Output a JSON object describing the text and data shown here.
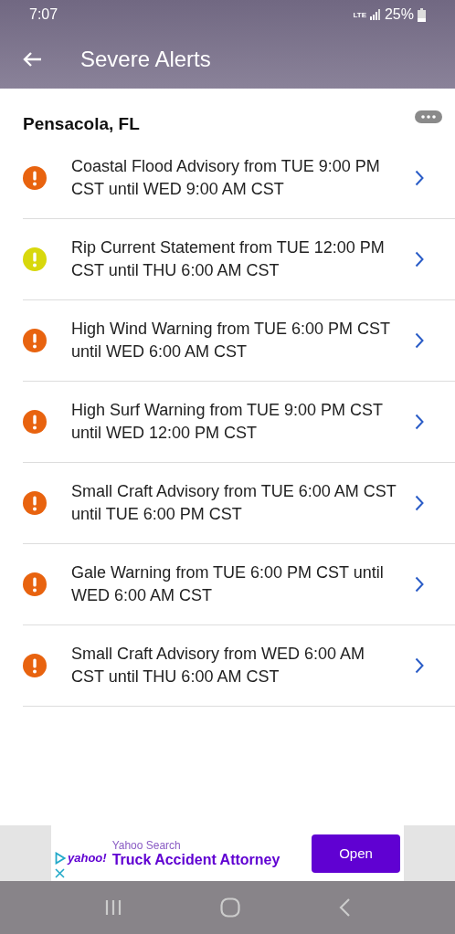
{
  "status_bar": {
    "time": "7:07",
    "network": "LTE",
    "battery": "25%"
  },
  "app_bar": {
    "title": "Severe Alerts"
  },
  "location": "Pensacola, FL",
  "alerts": [
    {
      "text": "Coastal Flood Advisory from TUE 9:00 PM CST until WED 9:00 AM CST",
      "color": "#e8630f"
    },
    {
      "text": "Rip Current Statement from TUE 12:00 PM CST until THU 6:00 AM CST",
      "color": "#d8d80c"
    },
    {
      "text": "High Wind Warning from TUE 6:00 PM CST until WED 6:00 AM CST",
      "color": "#e8630f"
    },
    {
      "text": "High Surf Warning from TUE 9:00 PM CST until WED 12:00 PM CST",
      "color": "#e8630f"
    },
    {
      "text": "Small Craft Advisory from TUE 6:00 AM CST until TUE 6:00 PM CST",
      "color": "#e8630f"
    },
    {
      "text": "Gale Warning from TUE 6:00 PM CST until WED 6:00 AM CST",
      "color": "#e8630f"
    },
    {
      "text": "Small Craft Advisory from WED 6:00 AM CST until THU 6:00 AM CST",
      "color": "#e8630f"
    }
  ],
  "ad": {
    "logo": "yahoo!",
    "sponsor": "Yahoo Search",
    "headline": "Truck Accident Attorney",
    "button": "Open"
  }
}
